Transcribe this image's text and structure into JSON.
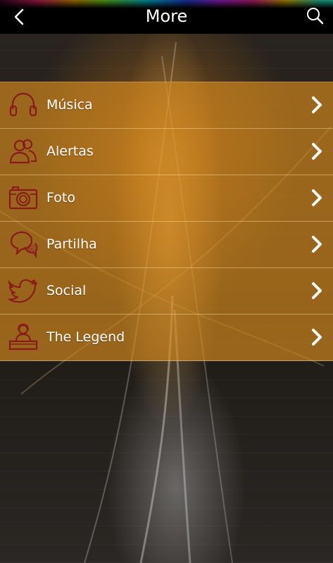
{
  "header": {
    "title": "More"
  },
  "menu": {
    "items": [
      {
        "label": "Música",
        "icon": "headphones-icon"
      },
      {
        "label": "Alertas",
        "icon": "users-icon"
      },
      {
        "label": "Foto",
        "icon": "camera-icon"
      },
      {
        "label": "Partilha",
        "icon": "chat-bubbles-icon"
      },
      {
        "label": "Social",
        "icon": "twitter-bird-icon"
      },
      {
        "label": "The Legend",
        "icon": "dj-icon"
      }
    ]
  },
  "colors": {
    "row_background": "#d78c1e",
    "icon_stroke": "#8a1a1a",
    "header_background": "#000000"
  }
}
